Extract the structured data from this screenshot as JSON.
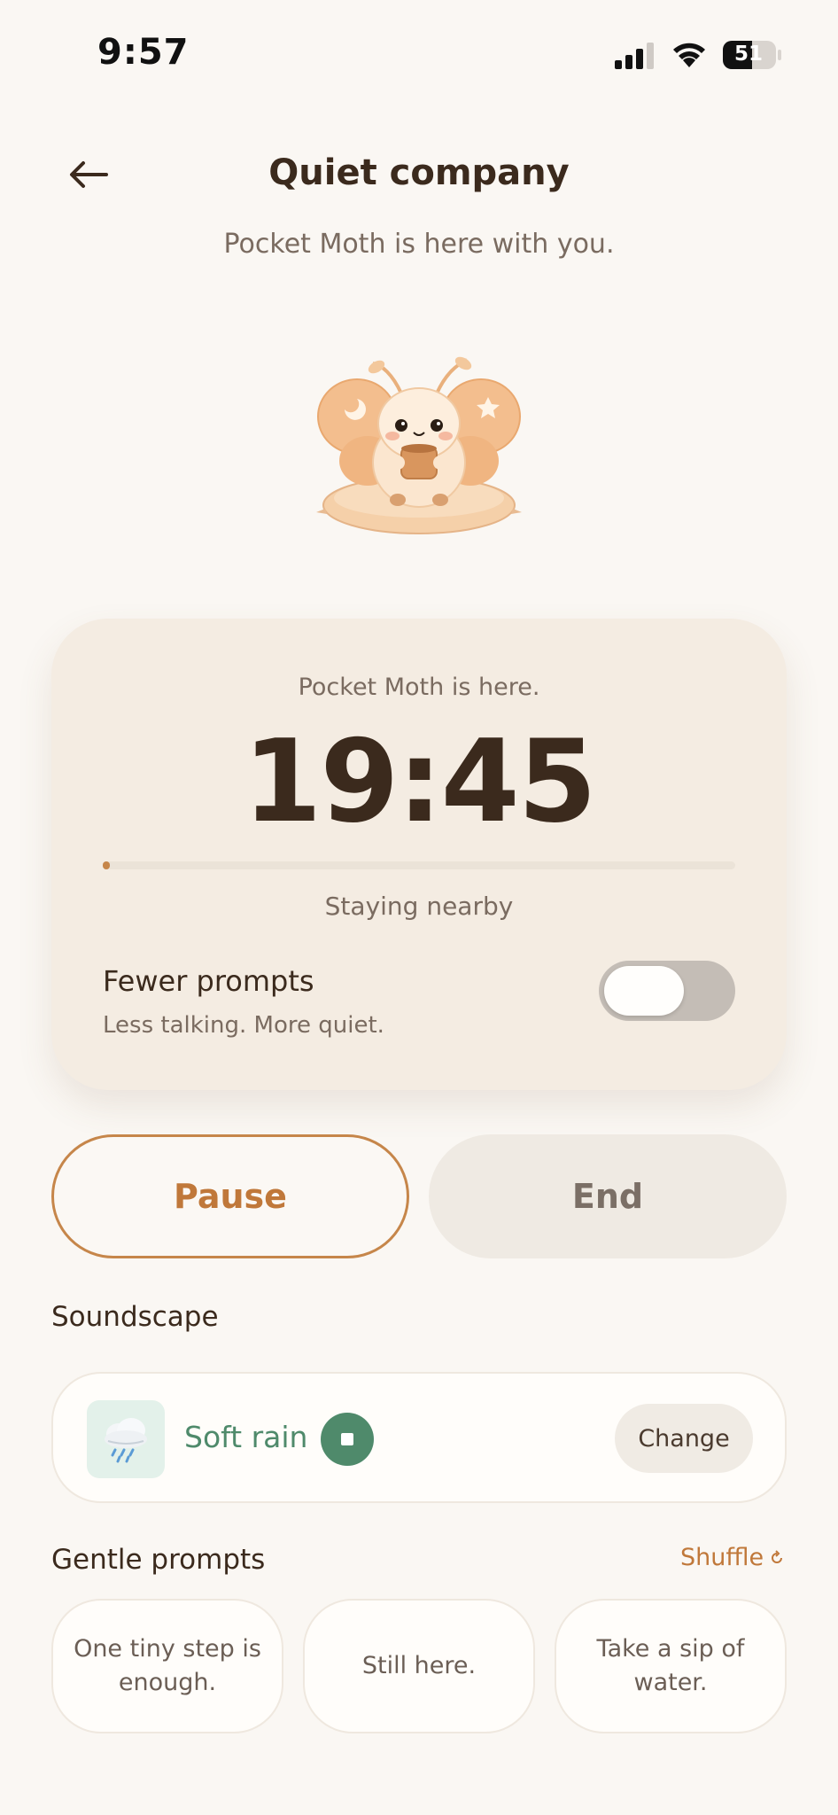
{
  "status_bar": {
    "time": "9:57",
    "battery": "51"
  },
  "header": {
    "title": "Quiet company",
    "subtitle": "Pocket Moth is here with you."
  },
  "timer_card": {
    "caption": "Pocket Moth is here.",
    "time_remaining": "19:45",
    "progress": 0.01,
    "progress_label": "Staying nearby",
    "fewer_prompts": {
      "title": "Fewer prompts",
      "description": "Less talking. More quiet.",
      "enabled": false
    }
  },
  "actions": {
    "pause_label": "Pause",
    "end_label": "End"
  },
  "soundscape": {
    "section_title": "Soundscape",
    "icon": "rain-cloud-icon",
    "name": "Soft rain",
    "change_label": "Change"
  },
  "prompts": {
    "section_title": "Gentle prompts",
    "shuffle_label": "Shuffle",
    "items": [
      "One tiny step is enough.",
      "Still here.",
      "Take a sip of water."
    ]
  },
  "colors": {
    "accent": "#c6864a",
    "sound_green": "#4f8a6b",
    "background": "#faf7f3",
    "card": "#f4ece2",
    "text_dark": "#3b2a1d"
  }
}
